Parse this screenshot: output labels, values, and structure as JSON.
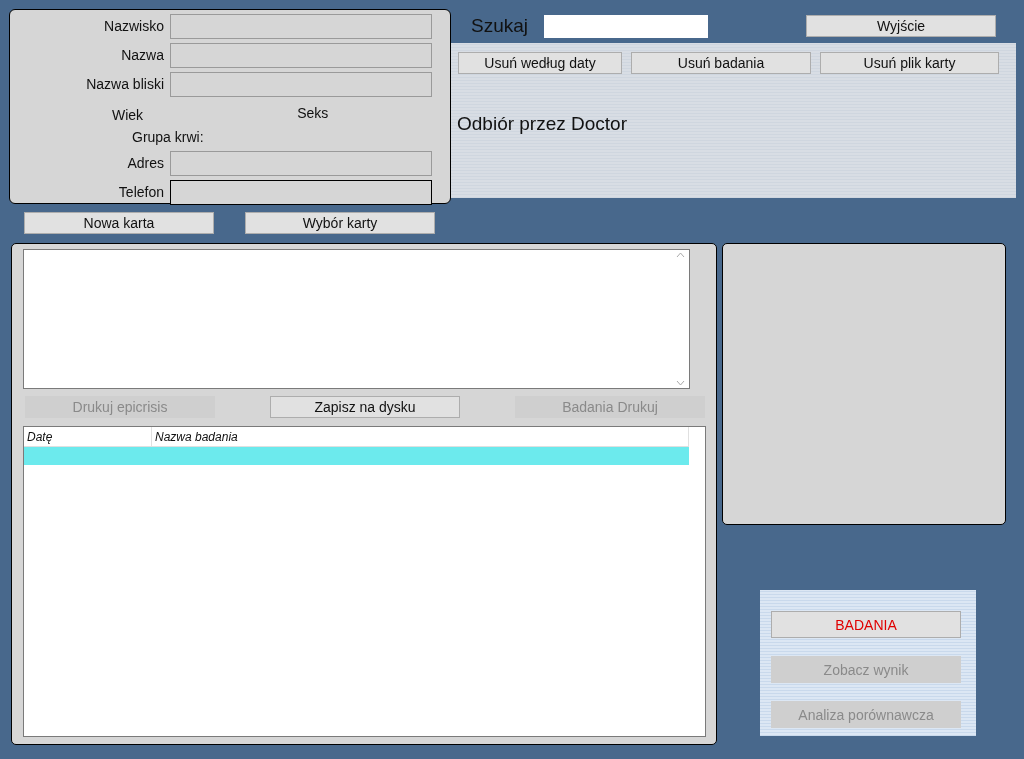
{
  "patient_form": {
    "fields": [
      {
        "label": "Nazwisko",
        "selected": false
      },
      {
        "label": "Nazwa",
        "selected": false
      },
      {
        "label": "Nazwa bliski",
        "selected": false
      },
      {
        "label": "Adres",
        "selected": false
      },
      {
        "label": "Telefon",
        "selected": true
      }
    ],
    "age_label": "Wiek",
    "sex_label": "Seks",
    "blood_group_label": "Grupa krwi:"
  },
  "card_buttons": [
    {
      "label": "Nowa karta",
      "disabled": false
    },
    {
      "label": "Wybór karty",
      "disabled": false
    }
  ],
  "search": {
    "label": "Szukaj"
  },
  "exit_button": {
    "label": "Wyjście",
    "disabled": false
  },
  "delete_buttons": [
    {
      "label": "Usuń według daty",
      "disabled": false
    },
    {
      "label": "Usuń badania",
      "disabled": false
    },
    {
      "label": "Usuń plik karty",
      "disabled": false
    }
  ],
  "pickup_text": "Odbiór przez Doctor",
  "action_buttons": [
    {
      "label": "Drukuj epicrisis",
      "disabled": true
    },
    {
      "label": "Zapisz na dysku",
      "disabled": false
    },
    {
      "label": "Badania Drukuj",
      "disabled": true
    }
  ],
  "table": {
    "columns": [
      "Datę",
      "Nazwa badania"
    ],
    "rows": [
      {
        "selected": true
      }
    ]
  },
  "exam_buttons": [
    {
      "label": "BADANIA",
      "disabled": false,
      "color": "#e00000"
    },
    {
      "label": "Zobacz wynik",
      "disabled": true
    },
    {
      "label": "Analiza porównawcza",
      "disabled": true
    }
  ]
}
